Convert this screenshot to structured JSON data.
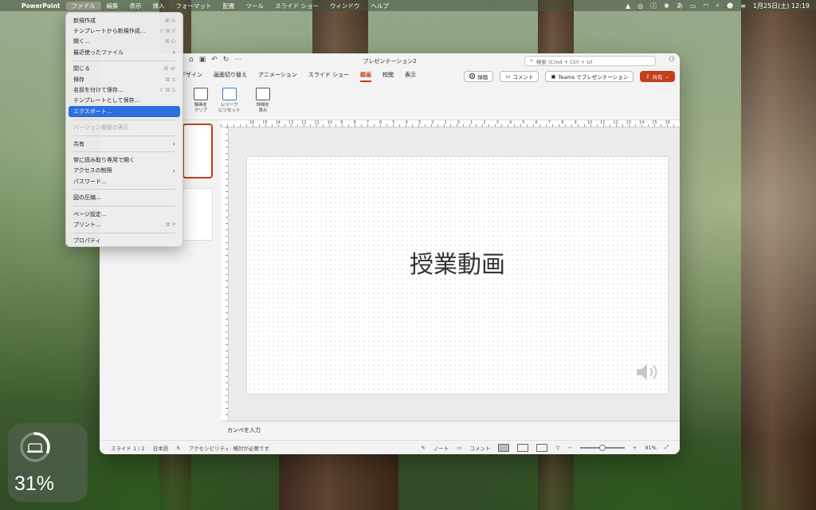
{
  "menubar": {
    "app": "PowerPoint",
    "items": [
      "ファイル",
      "編集",
      "表示",
      "挿入",
      "フォーマット",
      "配置",
      "ツール",
      "スライド ショー",
      "ウィンドウ",
      "ヘルプ"
    ],
    "clock": "1月25日(土)  12:19",
    "input_mode": "あ"
  },
  "window": {
    "title": "プレゼンテーション2",
    "search_placeholder": "検索 (Cmd + Ctrl + U)",
    "tabs": [
      "デザイン",
      "画面切り替え",
      "アニメーション",
      "スライド ショー",
      "録画",
      "校閲",
      "表示"
    ],
    "active_tab": "録画",
    "record_label": "録画",
    "comment_label": "コメント",
    "teams_label": "Teams でプレゼンテーション",
    "share_label": "共有",
    "tools": [
      {
        "label1": "録画を",
        "label2": "クリア"
      },
      {
        "label1": "レリーフ",
        "label2": "にリセット"
      },
      {
        "label1": "詳細を",
        "label2": "表示"
      }
    ],
    "ruler_numbers": [
      "16",
      "15",
      "14",
      "13",
      "12",
      "11",
      "10",
      "9",
      "8",
      "7",
      "6",
      "5",
      "4",
      "3",
      "2",
      "1",
      "0",
      "1",
      "2",
      "3",
      "4",
      "5",
      "6",
      "7",
      "8",
      "9",
      "10",
      "11",
      "12",
      "13",
      "14",
      "15",
      "16"
    ],
    "slide_title": "授業動画",
    "notes_placeholder": "カンペを入力",
    "status": {
      "slide": "スライド 1 / 2",
      "language": "日本語",
      "accessibility": "アクセシビリティ: 検討が必要です",
      "notes": "ノート",
      "comments": "コメント",
      "zoom": "91%"
    }
  },
  "file_menu": {
    "items": [
      {
        "label": "新規作成",
        "shortcut": "⌘ N"
      },
      {
        "label": "テンプレートから新規作成...",
        "shortcut": "⇧ ⌘ P"
      },
      {
        "label": "開く...",
        "shortcut": "⌘ O"
      },
      {
        "label": "最近使ったファイル",
        "shortcut": "›"
      },
      {
        "label": "閉じる",
        "shortcut": "⌘ W"
      },
      {
        "label": "保存",
        "shortcut": "⌘ S"
      },
      {
        "label": "名前を付けて保存...",
        "shortcut": "⇧ ⌘ S"
      },
      {
        "label": "テンプレートとして保存...",
        "shortcut": ""
      },
      {
        "label": "エクスポート...",
        "shortcut": ""
      },
      {
        "label": "バージョン履歴の表示",
        "shortcut": ""
      },
      {
        "label": "共有",
        "shortcut": "›"
      },
      {
        "label": "常に読み取り専用で開く",
        "shortcut": ""
      },
      {
        "label": "アクセスの制限",
        "shortcut": "›"
      },
      {
        "label": "パスワード...",
        "shortcut": ""
      },
      {
        "label": "図の圧縮...",
        "shortcut": ""
      },
      {
        "label": "ページ設定...",
        "shortcut": ""
      },
      {
        "label": "プリント...",
        "shortcut": "⌘ P"
      },
      {
        "label": "プロパティ",
        "shortcut": ""
      }
    ]
  },
  "widget": {
    "battery_percent": "31%",
    "battery_level": 0.31
  },
  "colors": {
    "accent": "#c43e1c",
    "selection": "#2d6fe0"
  }
}
